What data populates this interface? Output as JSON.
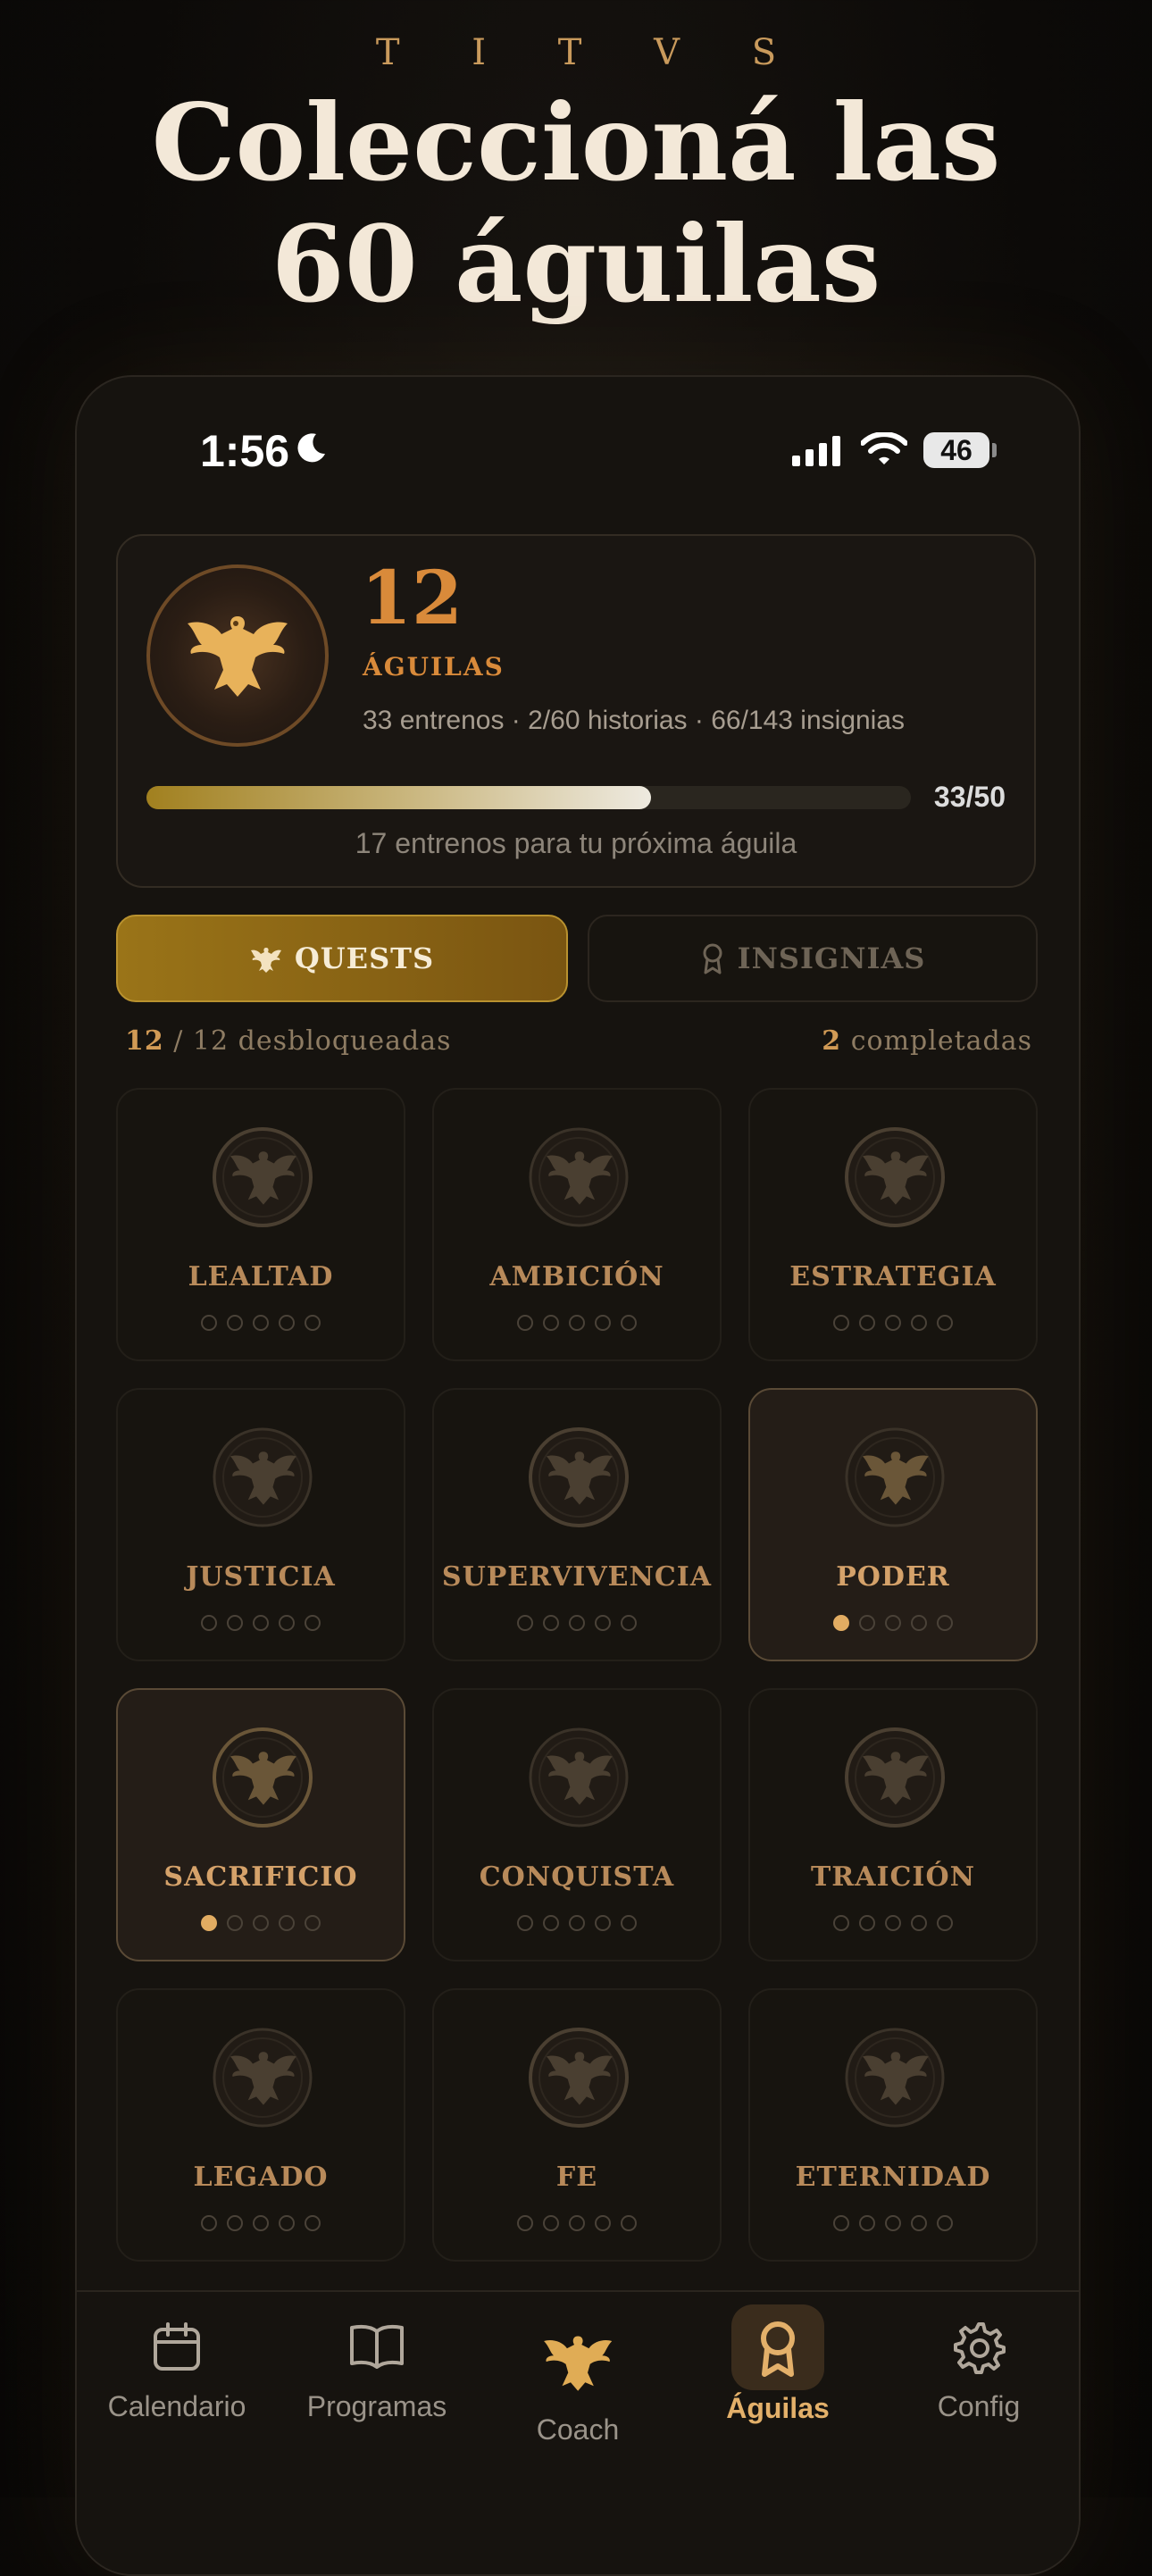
{
  "brand": "T I T V S",
  "headline": {
    "line1": "Coleccioná las",
    "line2": "60 águilas"
  },
  "status": {
    "time": "1:56",
    "battery": "46"
  },
  "summary": {
    "count": "12",
    "label": "ÁGUILAS",
    "stats": "33 entrenos · 2/60 historias · 66/143 insignias",
    "progress": {
      "fraction": 0.66,
      "value": "33/50"
    },
    "caption": "17 entrenos para tu próxima águila"
  },
  "segments": {
    "quests": "QUESTS",
    "insignias": "INSIGNIAS"
  },
  "meta": {
    "unlocked_num": "12",
    "unlocked_rest": " / 12 desbloqueadas",
    "completed_num": "2",
    "completed_rest": " completadas"
  },
  "eagles": [
    {
      "name": "LEALTAD",
      "progress": 0,
      "active": false
    },
    {
      "name": "AMBICIÓN",
      "progress": 0,
      "active": false
    },
    {
      "name": "ESTRATEGIA",
      "progress": 0,
      "active": false
    },
    {
      "name": "JUSTICIA",
      "progress": 0,
      "active": false
    },
    {
      "name": "SUPERVIVENCIA",
      "progress": 0,
      "active": false
    },
    {
      "name": "PODER",
      "progress": 1,
      "active": true
    },
    {
      "name": "SACRIFICIO",
      "progress": 1,
      "active": true
    },
    {
      "name": "CONQUISTA",
      "progress": 0,
      "active": false
    },
    {
      "name": "TRAICIÓN",
      "progress": 0,
      "active": false
    },
    {
      "name": "LEGADO",
      "progress": 0,
      "active": false
    },
    {
      "name": "FE",
      "progress": 0,
      "active": false
    },
    {
      "name": "ETERNIDAD",
      "progress": 0,
      "active": false
    }
  ],
  "tabs": {
    "calendario": "Calendario",
    "programas": "Programas",
    "coach": "Coach",
    "aguilas": "Águilas",
    "config": "Config"
  },
  "colors": {
    "accent": "#d98a3a",
    "gold": "#e2ac62",
    "background": "#0c0a08"
  }
}
